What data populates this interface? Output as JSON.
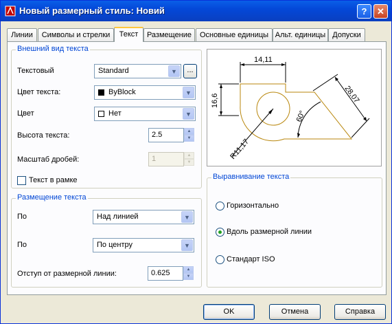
{
  "window": {
    "title": "Новый размерный стиль: Новий",
    "help_label": "?",
    "close_label": "✕"
  },
  "tabs": [
    {
      "label": "Линии"
    },
    {
      "label": "Символы и стрелки"
    },
    {
      "label": "Текст",
      "active": true
    },
    {
      "label": "Размещение"
    },
    {
      "label": "Основные единицы"
    },
    {
      "label": "Альт. единицы"
    },
    {
      "label": "Допуски"
    }
  ],
  "appearance": {
    "title": "Внешний вид текста",
    "style_label": "Текстовый",
    "style_value": "Standard",
    "browse_label": "...",
    "text_color_label": "Цвет текста:",
    "text_color_value": "ByBlock",
    "text_color_swatch": "#000000",
    "fill_color_label": "Цвет",
    "fill_color_value": "Нет",
    "fill_color_swatch": "#ffffff",
    "height_label": "Высота текста:",
    "height_value": "2.5",
    "fraction_label": "Масштаб дробей:",
    "fraction_value": "1",
    "frame_label": "Текст в рамке",
    "frame_checked": false
  },
  "placement": {
    "title": "Размещение текста",
    "vertical_label": "По",
    "vertical_value": "Над линией",
    "horizontal_label": "По",
    "horizontal_value": "По центру",
    "offset_label": "Отступ от размерной линии:",
    "offset_value": "0.625"
  },
  "preview": {
    "dim_top": "14,11",
    "dim_left": "16,6",
    "dim_right": "28,07",
    "dim_angle": "60°",
    "dim_radius": "R11,17"
  },
  "alignment": {
    "title": "Выравнивание текста",
    "options": [
      {
        "label": "Горизонтально",
        "selected": false
      },
      {
        "label": "Вдоль размерной линии",
        "selected": true
      },
      {
        "label": "Стандарт ISO",
        "selected": false
      }
    ]
  },
  "footer": {
    "ok_label": "OK",
    "cancel_label": "Отмена",
    "help_label": "Справка"
  },
  "colors": {
    "titlebar": "#0448d8",
    "group_title": "#0046d5",
    "tab_active_accent": "#ffc73c",
    "radio_dot": "#21a121",
    "preview_outline": "#b8860b"
  }
}
